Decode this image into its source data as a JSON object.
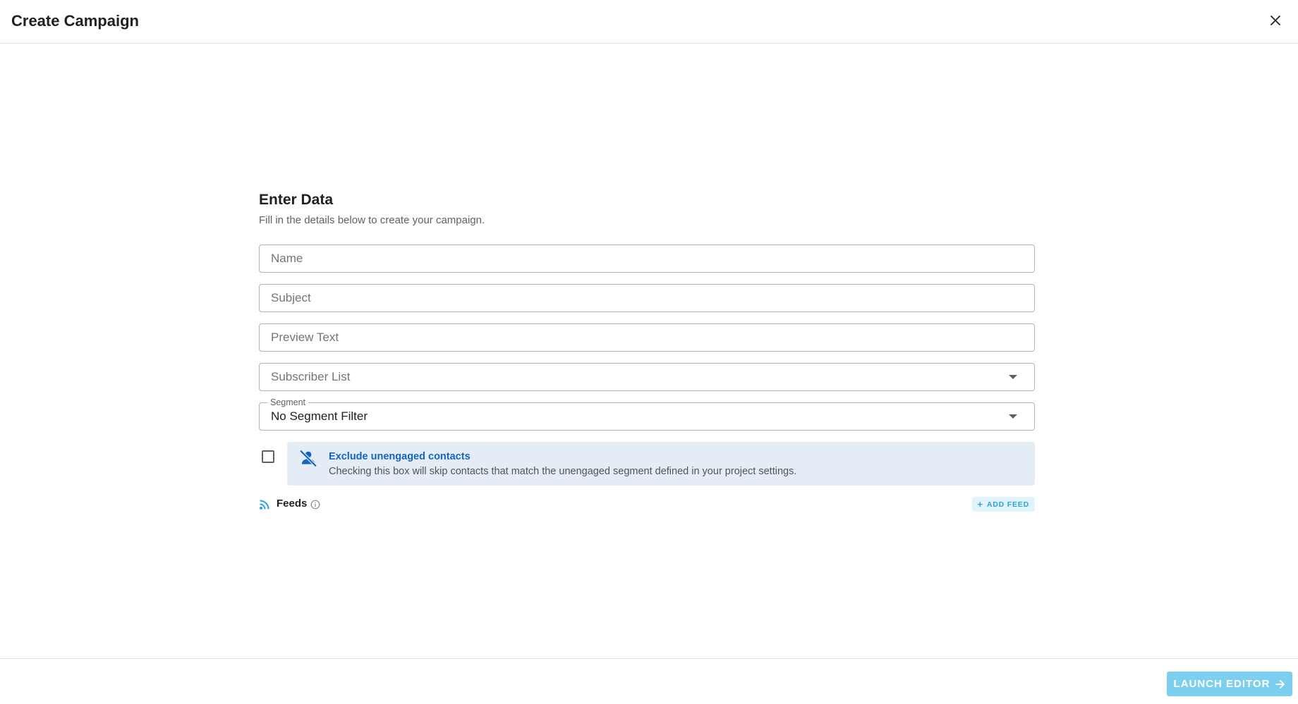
{
  "header": {
    "title": "Create Campaign",
    "close_icon": "close-icon"
  },
  "form": {
    "title": "Enter Data",
    "subtitle": "Fill in the details below to create your campaign.",
    "name_placeholder": "Name",
    "name_value": "",
    "subject_placeholder": "Subject",
    "subject_value": "",
    "preview_placeholder": "Preview Text",
    "preview_value": "",
    "subscriber_list_placeholder": "Subscriber List",
    "segment_label": "Segment",
    "segment_value": "No Segment Filter",
    "exclude": {
      "checked": false,
      "title": "Exclude unengaged contacts",
      "description": "Checking this box will skip contacts that match the unengaged segment defined in your project settings.",
      "icon": "person-off-icon"
    },
    "feeds": {
      "label": "Feeds",
      "icon": "rss-feed-icon",
      "info_icon": "info-icon",
      "add_label": "ADD FEED"
    }
  },
  "footer": {
    "launch_label": "LAUNCH EDITOR",
    "launch_icon": "arrow-right-icon"
  },
  "colors": {
    "accent": "#29a3d9",
    "launch_bg": "#7dcff0",
    "info_bg": "#e4ecf6",
    "info_title": "#1565c0"
  }
}
